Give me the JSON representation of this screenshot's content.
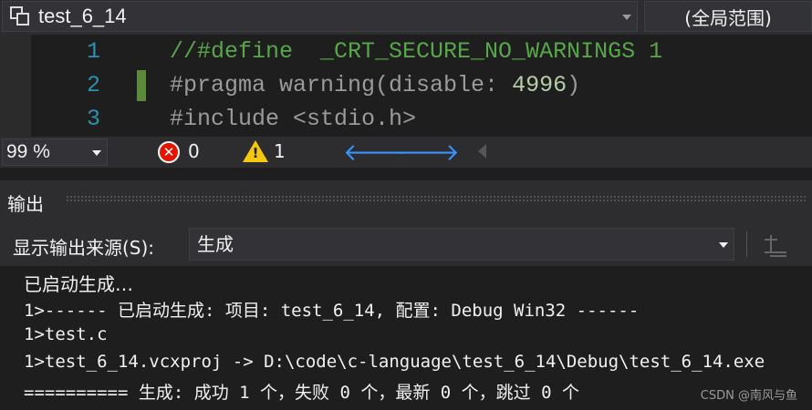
{
  "nav_bar": {
    "project": "test_6_14",
    "scope": "(全局范围)"
  },
  "editor": {
    "lines": [
      {
        "number": "1",
        "tokens": [
          {
            "kind": "comment",
            "text": "//#define  _CRT_SECURE_NO_WARNINGS 1"
          }
        ]
      },
      {
        "number": "2",
        "tokens": [
          {
            "kind": "pre",
            "text": "#pragma warning(disable: "
          },
          {
            "kind": "num",
            "text": "4996"
          },
          {
            "kind": "pre",
            "text": ")"
          }
        ]
      },
      {
        "number": "3",
        "tokens": [
          {
            "kind": "pre",
            "text": "#include <stdio.h>"
          }
        ]
      }
    ],
    "changed_line": 2
  },
  "status": {
    "zoom": "99 %",
    "errors": "0",
    "warnings": "1"
  },
  "output": {
    "title": "输出",
    "source_label": "显示输出来源(S):",
    "source_value": "生成",
    "lines": [
      "已启动生成…",
      "1>------ 已启动生成: 项目: test_6_14, 配置: Debug Win32 ------",
      "1>test.c",
      "1>test_6_14.vcxproj -> D:\\code\\c-language\\test_6_14\\Debug\\test_6_14.exe",
      "========== 生成: 成功 1 个，失败 0 个，最新 0 个，跳过 0 个"
    ]
  },
  "watermark": "CSDN @南风与鱼",
  "icons": {
    "project": "project-icon",
    "error": "error-icon",
    "warning": "warning-icon",
    "back": "arrow-left-icon",
    "forward": "arrow-right-icon",
    "goto_code": "go-to-code-icon"
  },
  "colors": {
    "background": "#1e1e1e",
    "chrome": "#2d2d30",
    "line_number": "#2b91af",
    "comment": "#57a64a",
    "preprocessor": "#9b9b9b",
    "number": "#b5cea8",
    "change_mark": "#5b8a3a",
    "error": "#e51400",
    "warning": "#f2c811",
    "nav_arrow": "#3794ff"
  }
}
